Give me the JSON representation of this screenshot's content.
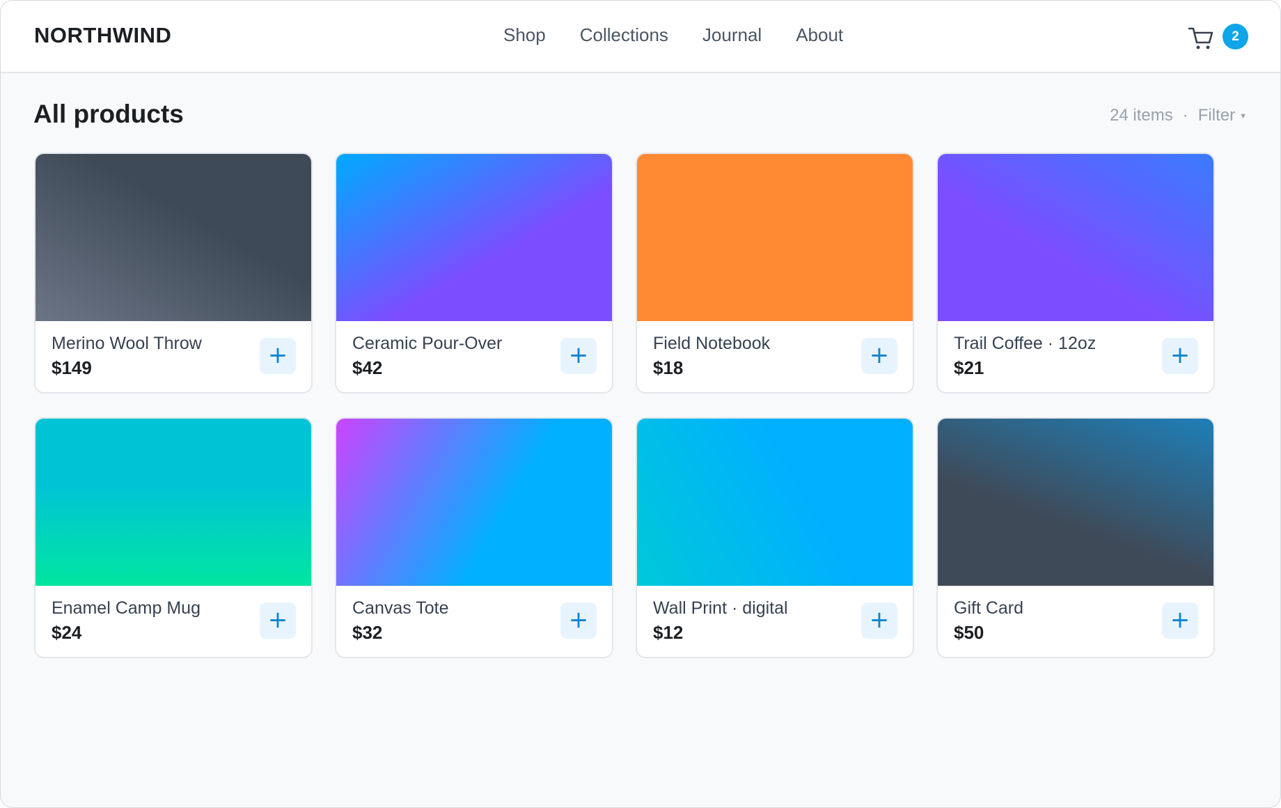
{
  "brand": "NORTHWIND",
  "nav": [
    "Shop",
    "Collections",
    "Journal",
    "About"
  ],
  "cart": {
    "icon": "cart-icon",
    "count": "2"
  },
  "page": {
    "title": "All products",
    "count_label": "24 items",
    "separator": "·",
    "filter_label": "Filter"
  },
  "colors": {
    "accent": "#0ea5e9",
    "add_button_bg": "#e8f4fd",
    "add_button_fg": "#0a84d0"
  },
  "products": [
    {
      "name": "Merino Wool Throw",
      "price": "$149",
      "gradient": [
        "#6b7585",
        "#3f4a58"
      ]
    },
    {
      "name": "Ceramic Pour-Over",
      "price": "$42",
      "gradient": [
        "#00aaff",
        "#7c4dff"
      ]
    },
    {
      "name": "Field Notebook",
      "price": "$18",
      "gradient": [
        "#ff8a33",
        "#ff8a33"
      ]
    },
    {
      "name": "Trail Coffee · 12oz",
      "price": "$21",
      "gradient": [
        "#3a7bff",
        "#7c4dff"
      ]
    },
    {
      "name": "Enamel Camp Mug",
      "price": "$24",
      "gradient": [
        "#00e5a0",
        "#00c4d6"
      ]
    },
    {
      "name": "Canvas Tote",
      "price": "$32",
      "gradient": [
        "#cc44ff",
        "#00b0ff"
      ]
    },
    {
      "name": "Wall Print · digital",
      "price": "$12",
      "gradient": [
        "#00c8d8",
        "#00b0ff"
      ]
    },
    {
      "name": "Gift Card",
      "price": "$50",
      "gradient": [
        "#1e7fb8",
        "#3f4a58"
      ]
    }
  ]
}
